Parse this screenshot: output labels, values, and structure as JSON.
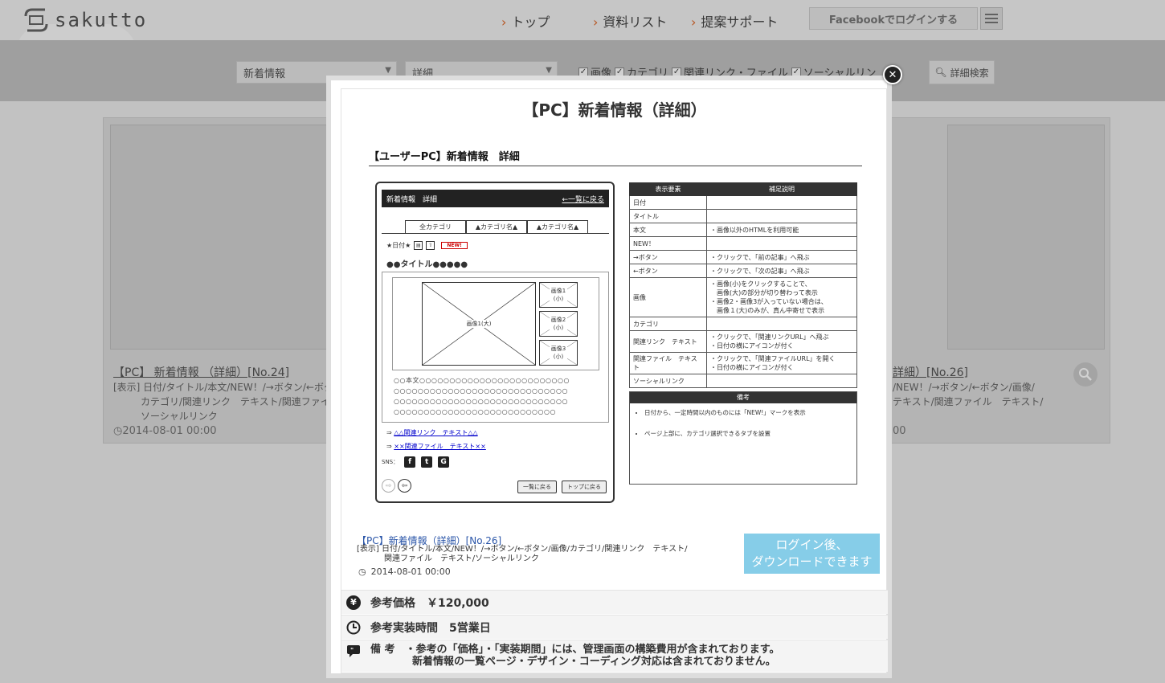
{
  "header": {
    "logo_text": "sakutto",
    "nav": [
      {
        "label": "トップ"
      },
      {
        "label": "資料リスト"
      },
      {
        "label": "提案サポート"
      }
    ],
    "facebook_login": "Facebookでログインする"
  },
  "filters": {
    "category1": "新着情報",
    "category2": "詳細",
    "checks": [
      "画像",
      "カテゴリ",
      "関連リンク・ファイル",
      "ソーシャルリン"
    ],
    "search_label": "詳細検索"
  },
  "bg_cards": {
    "left": {
      "title": "【PC】 新着情報 （詳細）[No.24]",
      "desc_line1": "[表示] 日付/タイトル/本文/NEW！/→ボタン/←ボタ",
      "desc_line2": "カテゴリ/関連リンク　テキスト/関連ファイル",
      "desc_line3": "ソーシャルリンク",
      "date": "2014-08-01 00:00"
    },
    "right": {
      "title": "詳細）[No.26]",
      "desc_line1": "/NEW！/→ボタン/←ボタン/画像/",
      "desc_line2": "テキスト/関連ファイル　テキスト/",
      "date": "00"
    }
  },
  "modal": {
    "title": "【PC】新着情報（詳細）",
    "wireframe": {
      "title": "【ユーザーPC】新着情報　詳細",
      "header_left": "新着情報　詳細",
      "header_right": "←一覧に戻る",
      "tabs": [
        "全カテゴリ",
        "▲カテゴリ名▲",
        "▲カテゴリ名▲"
      ],
      "date_label": "★日付★",
      "new_badge": "NEW!",
      "post_title": "●●タイトル●●●●●",
      "main_image": "画像1(大)",
      "thumbs": [
        {
          "name": "画像1",
          "size": "(小)"
        },
        {
          "name": "画像2",
          "size": "(小)"
        },
        {
          "name": "画像3",
          "size": "(小)"
        }
      ],
      "body_lines": [
        "○○本文○○○○○○○○○○○○○○○○○○○○○○○○○",
        "○○○○○○○○○○○○○○○○○○○○○○○○○○○○○",
        "○○○○○○○○○○○○○○○○○○○○○○○○○○○○○",
        "○○○○○○○○○○○○○○○○○○○○○○○○○○○"
      ],
      "link1": "△△関連リンク　テキスト△△",
      "link2": "××関連ファイル　テキスト××",
      "sns_label": "SNS：",
      "btn_list": "一覧に戻る",
      "btn_top": "トップに戻る"
    },
    "spec_table": {
      "headers": [
        "表示要素",
        "補足説明"
      ],
      "rows": [
        {
          "key": "日付",
          "val": ""
        },
        {
          "key": "タイトル",
          "val": ""
        },
        {
          "key": "本文",
          "val": "・画像以外のHTMLを利用可能"
        },
        {
          "key": "NEW！",
          "val": ""
        },
        {
          "key": "→ボタン",
          "val": "・クリックで、「前の記事」へ飛ぶ"
        },
        {
          "key": "←ボタン",
          "val": "・クリックで、「次の記事」へ飛ぶ"
        },
        {
          "key": "画像",
          "val": "・画像(小)をクリックすることで、\n　画像(大)の部分が切り替わって表示\n・画像2・画像3が入っていない場合は、\n　画像１(大)のみが、真ん中寄せで表示"
        },
        {
          "key": "カテゴリ",
          "val": ""
        },
        {
          "key": "関連リンク　テキスト",
          "val": "・クリックで、「関連リンクURL」へ飛ぶ\n・日付の横にアイコンが付く"
        },
        {
          "key": "関連ファイル　テキスト",
          "val": "・クリックで、「関連ファイルURL」を開く\n・日付の横にアイコンが付く"
        },
        {
          "key": "ソーシャルリンク",
          "val": ""
        }
      ]
    },
    "notes": {
      "header": "備考",
      "items": [
        "日付から、一定時間以内のものには「NEW!」マークを表示",
        "ページ上部に、カテゴリ選択できるタブを設置"
      ]
    },
    "item_link": "【PC】新着情報（詳細）[No.26]",
    "item_desc_line1": "[表示] 日付/タイトル/本文/NEW！/→ボタン/←ボタン/画像/カテゴリ/関連リンク　テキスト/",
    "item_desc_line2": "関連ファイル　テキスト/ソーシャルリンク",
    "item_date": "2014-08-01 00:00",
    "download_line1": "ログイン後、",
    "download_line2": "ダウンロードできます",
    "price": "参考価格　￥120,000",
    "time": "参考実装時間　5営業日",
    "note_line1": "備 考　・参考の「価格」・「実装期間」には、管理画面の構築費用が含まれております。",
    "note_line2": "新着情報の一覧ページ・デザイン・コーディング対応は含まれておりません。"
  },
  "colors": {
    "download_button": "#86cde8",
    "nav_chevron": "#e06a2a",
    "link": "#2a55a8"
  }
}
